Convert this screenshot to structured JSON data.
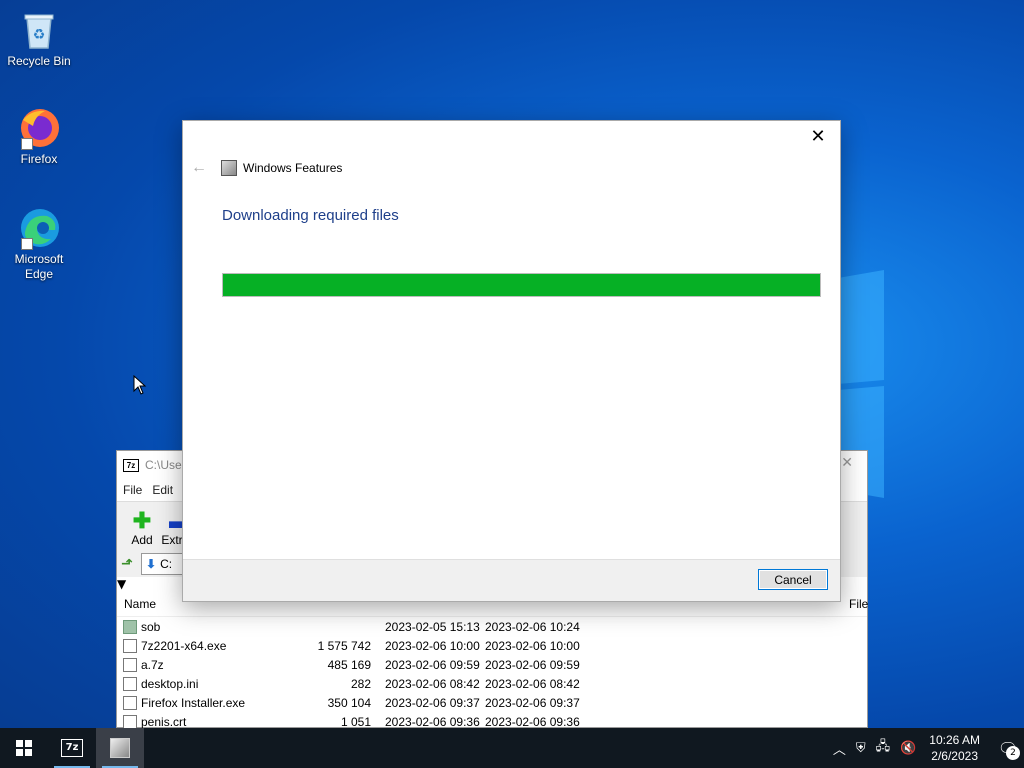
{
  "desktop": {
    "icons": [
      {
        "label": "Recycle Bin",
        "icon": "recycle-bin-icon"
      },
      {
        "label": "Firefox",
        "icon": "firefox-icon"
      },
      {
        "label": "Microsoft Edge",
        "icon": "edge-icon"
      }
    ]
  },
  "dialog": {
    "title": "Windows Features",
    "status": "Downloading required files",
    "progress_percent": 100,
    "progress_color": "#06b025",
    "cancel_label": "Cancel",
    "close_glyph": "✕"
  },
  "zip_window": {
    "title": "C:\\Users",
    "menu": [
      "File",
      "Edit"
    ],
    "toolbar": [
      {
        "label": "Add",
        "icon": "add-plus-icon"
      },
      {
        "label": "Extract",
        "icon": "extract-minus-icon"
      }
    ],
    "address": "C:",
    "columns": {
      "name": "Name",
      "file": "File"
    },
    "rows": [
      {
        "name": "sob",
        "size": "",
        "modified": "2023-02-05 15:13",
        "created": "2023-02-06 10:24",
        "type": "folder"
      },
      {
        "name": "7z2201-x64.exe",
        "size": "1 575 742",
        "modified": "2023-02-06 10:00",
        "created": "2023-02-06 10:00",
        "type": "exe"
      },
      {
        "name": "a.7z",
        "size": "485 169",
        "modified": "2023-02-06 09:59",
        "created": "2023-02-06 09:59",
        "type": "7z"
      },
      {
        "name": "desktop.ini",
        "size": "282",
        "modified": "2023-02-06 08:42",
        "created": "2023-02-06 08:42",
        "type": "ini"
      },
      {
        "name": "Firefox Installer.exe",
        "size": "350 104",
        "modified": "2023-02-06 09:37",
        "created": "2023-02-06 09:37",
        "type": "exe"
      },
      {
        "name": "penis.crt",
        "size": "1 051",
        "modified": "2023-02-06 09:36",
        "created": "2023-02-06 09:36",
        "type": "crt"
      }
    ]
  },
  "taskbar": {
    "zip_label": "7z",
    "time": "10:26 AM",
    "date": "2/6/2023",
    "notification_count": "2"
  }
}
